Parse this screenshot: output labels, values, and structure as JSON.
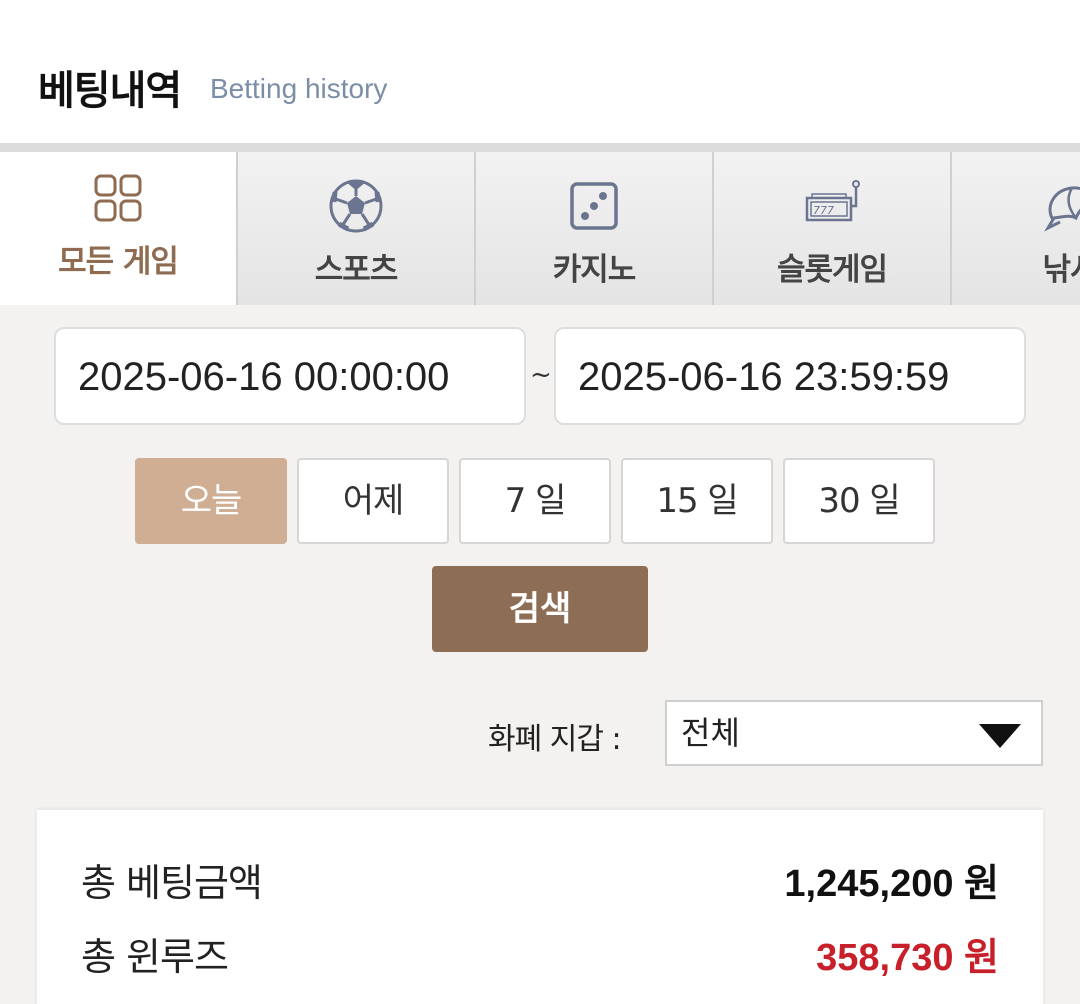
{
  "header": {
    "title": "베팅내역",
    "subtitle": "Betting history"
  },
  "tabs": [
    {
      "label": "모든 게임",
      "icon": "grid-icon",
      "active": true
    },
    {
      "label": "스포츠",
      "icon": "soccer-ball-icon",
      "active": false
    },
    {
      "label": "카지노",
      "icon": "dice-icon",
      "active": false
    },
    {
      "label": "슬롯게임",
      "icon": "slot-machine-icon",
      "active": false
    },
    {
      "label": "낚시",
      "icon": "fish-icon",
      "active": false
    }
  ],
  "date_range": {
    "start": "2025-06-16 00:00:00",
    "separator": "~",
    "end": "2025-06-16 23:59:59"
  },
  "quick_ranges": [
    {
      "label": "오늘",
      "selected": true
    },
    {
      "label": "어제",
      "selected": false
    },
    {
      "label": "7 일",
      "selected": false
    },
    {
      "label": "15 일",
      "selected": false
    },
    {
      "label": "30 일",
      "selected": false
    }
  ],
  "search_label": "검색",
  "wallet": {
    "label": "화폐 지갑 :",
    "selected": "전체"
  },
  "summary": {
    "total_bet_label": "총 베팅금액",
    "total_bet_value": "1,245,200 원",
    "total_winloss_label": "총 윈루즈",
    "total_winloss_value": "358,730 원"
  },
  "colors": {
    "accent": "#cfae93",
    "brand_dark": "#8d6e55",
    "loss_red": "#c8202a",
    "icon": "#6b7590"
  }
}
